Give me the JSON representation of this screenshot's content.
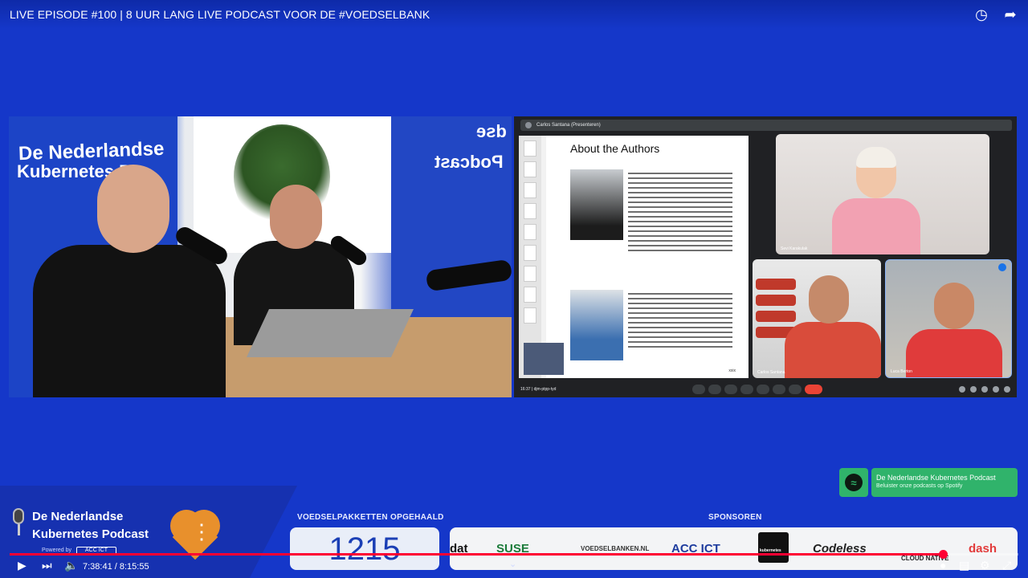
{
  "video": {
    "title": "LIVE EPISODE #100 | 8 UUR LANG LIVE PODCAST VOOR DE #VOEDSELBANK",
    "icons": [
      "clock-icon",
      "share-icon"
    ]
  },
  "studio_cam": {
    "banner_left_line1": "De Nederlandse",
    "banner_left_line2": "Kubernetes P",
    "banner_right_line1": "dse",
    "banner_right_line2": "Podcast"
  },
  "meeting": {
    "presenter_label": "Carlos Santana (Presenteren)",
    "slide_title": "About the Authors",
    "page_number": "xxix",
    "participants": [
      "Sevi Karakulak",
      "Carlos Santana",
      "Luca Berton"
    ],
    "clock": "16:37",
    "meeting_code": "djm-ptpp-tyd"
  },
  "spotify": {
    "title": "De Nederlandse Kubernetes Podcast",
    "subtitle": "Beluister onze podcasts op Spotify"
  },
  "overlay": {
    "brand_line1": "De Nederlandse",
    "brand_line2": "Kubernetes Podcast",
    "powered_by": "Powered by",
    "powered_logo": "ACC ICT",
    "counter_label": "VOEDSELPAKKETTEN OPGEHAALD",
    "counter_value": "1215",
    "sponsors_label": "SPONSOREN",
    "sponsors": [
      "dat",
      "SUSE",
      "VOEDSELBANKEN.NL",
      "ACC ICT",
      "kubernetes",
      "Codeless",
      "CLOUD NATIVE",
      "dash"
    ]
  },
  "player": {
    "current_time": "7:38:41",
    "duration": "8:15:55",
    "time_display": "7:38:41 / 8:15:55",
    "progress": 0.925,
    "icons": [
      "play-icon",
      "next-icon",
      "volume-icon",
      "autoplay-toggle-icon",
      "subtitles-icon",
      "settings-icon",
      "miniplayer-icon",
      "fullscreen-exit-icon"
    ]
  },
  "colors": {
    "background": "#1537c9",
    "accent_red": "#ff0033",
    "spotify_green": "#30b36b",
    "heart_orange": "#e8902c"
  }
}
